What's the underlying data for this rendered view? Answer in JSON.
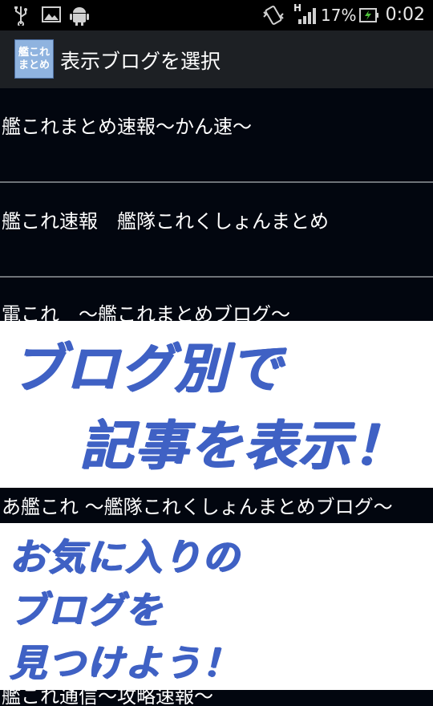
{
  "status_bar": {
    "icons": [
      "usb-icon",
      "image-icon",
      "android-icon",
      "vibrate-icon",
      "signal-icon",
      "battery-charging-icon"
    ],
    "signal_label": "H",
    "battery": "17%",
    "time": "0:02"
  },
  "action_bar": {
    "app_icon_line1": "艦これ",
    "app_icon_line2": "まとめ",
    "title": "表示ブログを選択"
  },
  "blogs": [
    "艦これまとめ速報〜かん速〜",
    "艦これ速報　艦隊これくしょんまとめ",
    "電これ　〜艦これまとめブログ〜",
    "あ艦これ 〜艦隊これくしょんまとめブログ〜",
    "艦これ通信〜攻略速報〜"
  ],
  "promo": {
    "line1": "ブログ別で",
    "line2": "記事を表示！",
    "line3": "お気に入りの",
    "line4": "ブログを",
    "line5": "見つけよう！"
  },
  "colors": {
    "background": "#02060f",
    "action_bar": "#1d2024",
    "promo_text": "#3f61c4",
    "divider": "#6f7378"
  }
}
